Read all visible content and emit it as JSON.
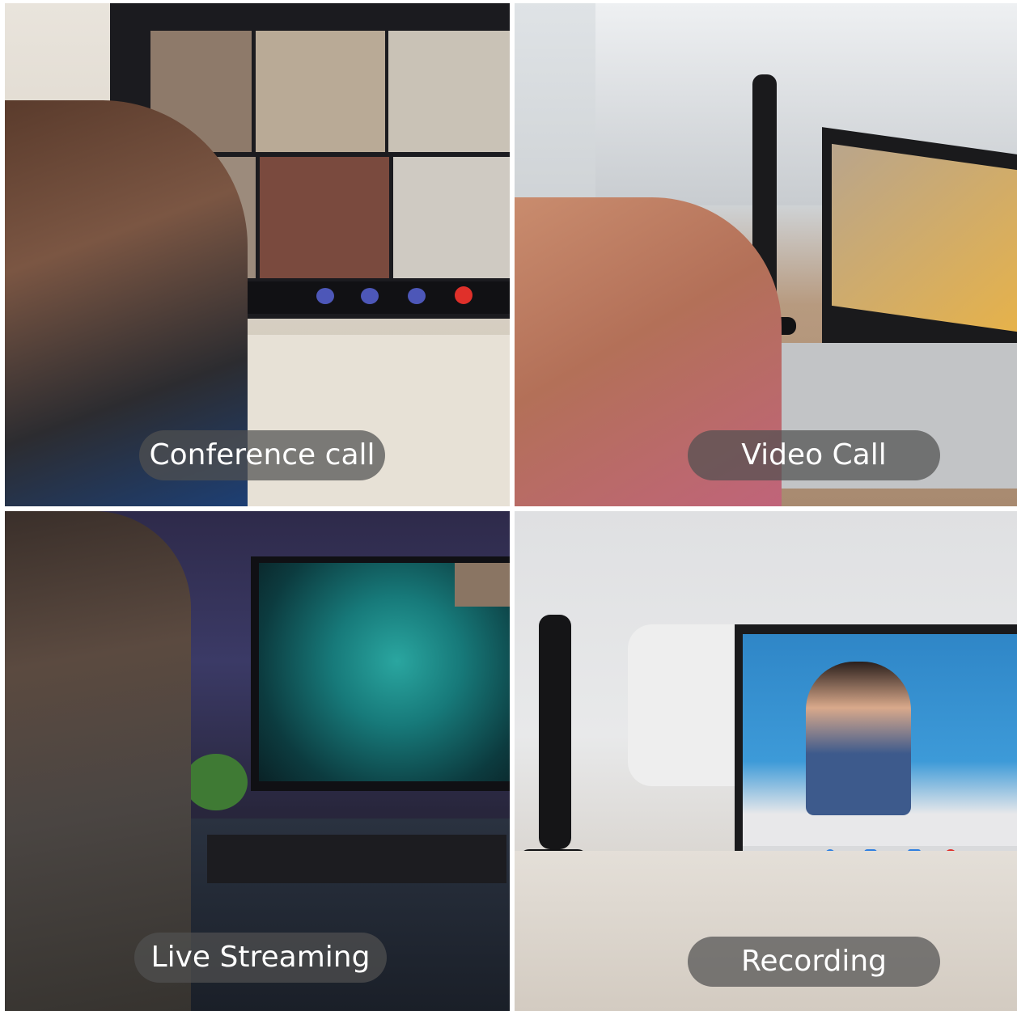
{
  "panels": [
    {
      "id": "conference",
      "caption": "Conference call"
    },
    {
      "id": "video",
      "caption": "Video Call"
    },
    {
      "id": "streaming",
      "caption": "Live Streaming"
    },
    {
      "id": "recording",
      "caption": "Recording"
    }
  ],
  "colors": {
    "caption_background": "#505050",
    "caption_text": "#ffffff",
    "call_end_red": "#e0302a",
    "call_icon_blue": "#2f7fe0"
  }
}
